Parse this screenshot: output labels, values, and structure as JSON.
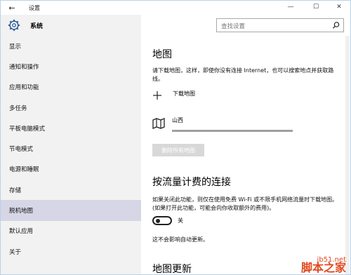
{
  "window": {
    "title": "设置",
    "back": "←",
    "minimize": "—",
    "maximize": "☐",
    "close": "✕"
  },
  "header": {
    "title": "系统",
    "search_placeholder": "查找设置"
  },
  "sidebar": {
    "items": [
      {
        "label": "显示"
      },
      {
        "label": "通知和操作"
      },
      {
        "label": "应用和功能"
      },
      {
        "label": "多任务"
      },
      {
        "label": "平板电脑模式"
      },
      {
        "label": "节电模式"
      },
      {
        "label": "电源和睡眠"
      },
      {
        "label": "存储"
      },
      {
        "label": "脱机地图",
        "active": true
      },
      {
        "label": "默认应用"
      },
      {
        "label": "关于"
      }
    ]
  },
  "main": {
    "maps_title": "地图",
    "maps_desc": "请下载地图，这样，即使你没有连接 Internet，也可以搜索地点并获取路线。",
    "download_label": "下载地图",
    "map_item": {
      "name": "山西",
      "progress": 1.0
    },
    "delete_all_label": "删除所有地图",
    "metered_title": "按流量计费的连接",
    "metered_desc": "如果关闭此功能，则仅在使用免费 Wi-Fi 或不限手机网络流量时下载地图。(如果打开此功能，可能会向你收取额外的费用)。",
    "toggle_label": "关",
    "toggle_on": false,
    "no_effect_note": "这不会影响自动更新。",
    "updates_title": "地图更新"
  },
  "watermark": {
    "site": "jb51.net",
    "brand": "脚本之家"
  },
  "colors": {
    "sidebar_bg": "#f2f2f2",
    "active_item_bg": "#d6d6e6",
    "disabled_button_bg": "#d8d8d8",
    "watermark": "#e04a1f"
  }
}
